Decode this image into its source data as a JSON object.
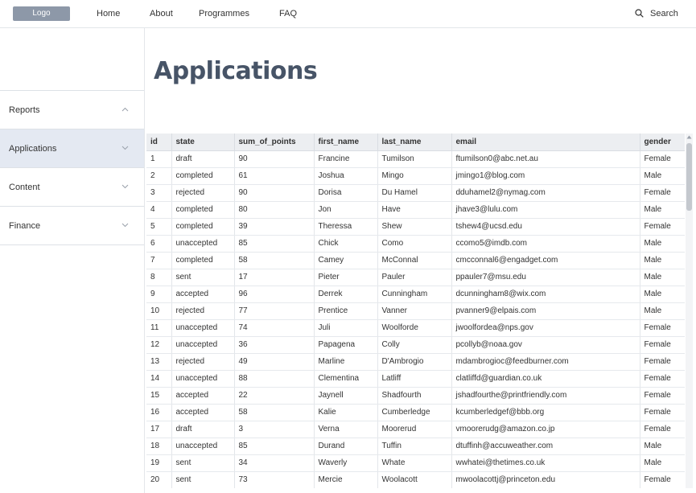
{
  "header": {
    "logo": "Logo",
    "nav": [
      "Home",
      "About",
      "Programmes",
      "FAQ"
    ],
    "search_label": "Search"
  },
  "sidebar": {
    "items": [
      {
        "label": "Reports",
        "chevron": "chevron-up-icon",
        "active": false
      },
      {
        "label": "Applications",
        "chevron": "chevron-down-icon",
        "active": true
      },
      {
        "label": "Content",
        "chevron": "chevron-down-icon",
        "active": false
      },
      {
        "label": "Finance",
        "chevron": "chevron-down-icon",
        "active": false
      }
    ]
  },
  "main": {
    "title": "Applications",
    "table": {
      "columns": [
        "id",
        "state",
        "sum_of_points",
        "first_name",
        "last_name",
        "email",
        "gender"
      ],
      "rows": [
        [
          "1",
          "draft",
          "90",
          "Francine",
          "Tumilson",
          "ftumilson0@abc.net.au",
          "Female"
        ],
        [
          "2",
          "completed",
          "61",
          "Joshua",
          "Mingo",
          "jmingo1@blog.com",
          "Male"
        ],
        [
          "3",
          "rejected",
          "90",
          "Dorisa",
          "Du Hamel",
          "dduhamel2@nymag.com",
          "Female"
        ],
        [
          "4",
          "completed",
          "80",
          "Jon",
          "Have",
          "jhave3@lulu.com",
          "Male"
        ],
        [
          "5",
          "completed",
          "39",
          "Theressa",
          "Shew",
          "tshew4@ucsd.edu",
          "Female"
        ],
        [
          "6",
          "unaccepted",
          "85",
          "Chick",
          "Como",
          "ccomo5@imdb.com",
          "Male"
        ],
        [
          "7",
          "completed",
          "58",
          "Camey",
          "McConnal",
          "cmcconnal6@engadget.com",
          "Male"
        ],
        [
          "8",
          "sent",
          "17",
          "Pieter",
          "Pauler",
          "ppauler7@msu.edu",
          "Male"
        ],
        [
          "9",
          "accepted",
          "96",
          "Derrek",
          "Cunningham",
          "dcunningham8@wix.com",
          "Male"
        ],
        [
          "10",
          "rejected",
          "77",
          "Prentice",
          "Vanner",
          "pvanner9@elpais.com",
          "Male"
        ],
        [
          "11",
          "unaccepted",
          "74",
          "Juli",
          "Woolforde",
          "jwoolfordea@nps.gov",
          "Female"
        ],
        [
          "12",
          "unaccepted",
          "36",
          "Papagena",
          "Colly",
          "pcollyb@noaa.gov",
          "Female"
        ],
        [
          "13",
          "rejected",
          "49",
          "Marline",
          "D'Ambrogio",
          "mdambrogioc@feedburner.com",
          "Female"
        ],
        [
          "14",
          "unaccepted",
          "88",
          "Clementina",
          "Latliff",
          "clatliffd@guardian.co.uk",
          "Female"
        ],
        [
          "15",
          "accepted",
          "22",
          "Jaynell",
          "Shadfourth",
          "jshadfourthe@printfriendly.com",
          "Female"
        ],
        [
          "16",
          "accepted",
          "58",
          "Kalie",
          "Cumberledge",
          "kcumberledgef@bbb.org",
          "Female"
        ],
        [
          "17",
          "draft",
          "3",
          "Verna",
          "Moorerud",
          "vmoorerudg@amazon.co.jp",
          "Female"
        ],
        [
          "18",
          "unaccepted",
          "85",
          "Durand",
          "Tuffin",
          "dtuffinh@accuweather.com",
          "Male"
        ],
        [
          "19",
          "sent",
          "34",
          "Waverly",
          "Whate",
          "wwhatei@thetimes.co.uk",
          "Male"
        ],
        [
          "20",
          "sent",
          "73",
          "Mercie",
          "Woolacott",
          "mwoolacottj@princeton.edu",
          "Female"
        ]
      ]
    }
  },
  "colors": {
    "accent": "#475467",
    "logo_bg": "#8d98a8",
    "active_bg": "#e4e9f2",
    "header_bg": "#eceef1"
  }
}
